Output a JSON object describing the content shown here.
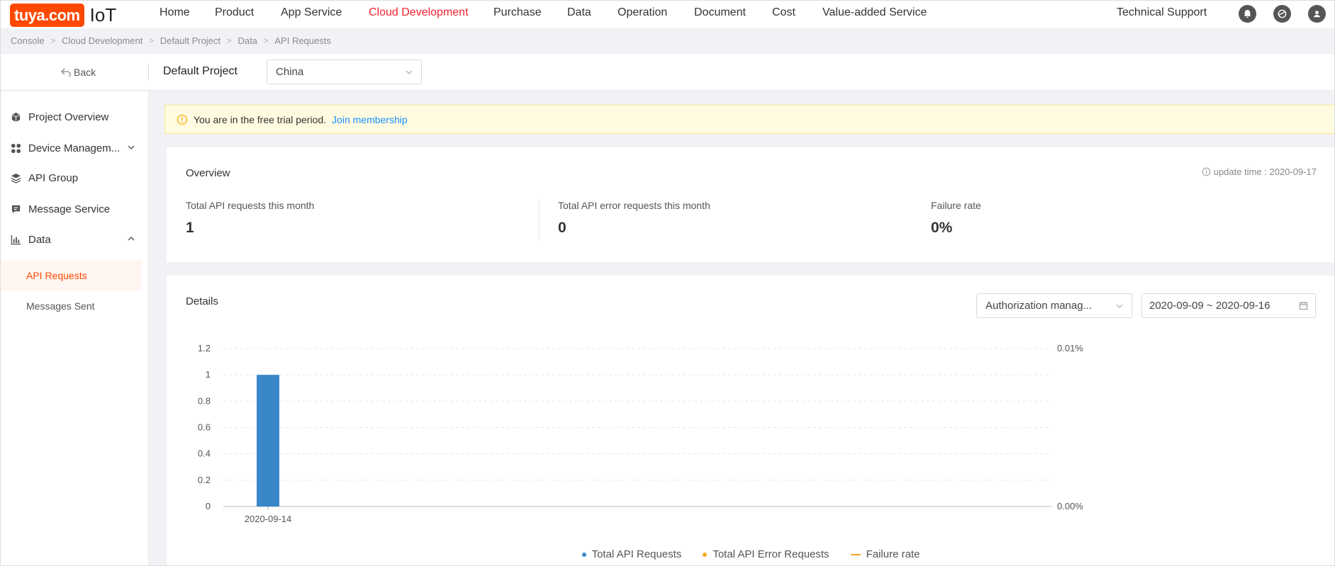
{
  "logo": {
    "brand": "tuya.com",
    "product": "IoT"
  },
  "nav": {
    "items": [
      "Home",
      "Product",
      "App Service",
      "Cloud Development",
      "Purchase",
      "Data",
      "Operation",
      "Document",
      "Cost",
      "Value-added Service"
    ],
    "active": "Cloud Development",
    "support": "Technical Support"
  },
  "breadcrumb": [
    "Console",
    "Cloud Development",
    "Default Project",
    "Data",
    "API Requests"
  ],
  "subheader": {
    "back": "Back",
    "project": "Default Project",
    "region": "China"
  },
  "sidebar": {
    "items": [
      {
        "label": "Project Overview",
        "icon": "cube-icon"
      },
      {
        "label": "Device Managem...",
        "icon": "grid-icon"
      },
      {
        "label": "API Group",
        "icon": "layers-icon"
      },
      {
        "label": "Message Service",
        "icon": "message-icon"
      },
      {
        "label": "Data",
        "icon": "bar-chart-icon"
      }
    ],
    "sub_items": [
      "API Requests",
      "Messages Sent"
    ],
    "active_sub": "API Requests"
  },
  "trial": {
    "text": "You are in the free trial period.",
    "link": "Join membership"
  },
  "overview": {
    "title": "Overview",
    "update_time": "update time : 2020-09-17",
    "stats": [
      {
        "label": "Total API requests this month",
        "value": "1"
      },
      {
        "label": "Total API error requests this month",
        "value": "0"
      },
      {
        "label": "Failure rate",
        "value": "0%"
      }
    ]
  },
  "details": {
    "title": "Details",
    "filter": "Authorization manag...",
    "date_range": "2020-09-09 ~ 2020-09-16"
  },
  "colors": {
    "brand": "#ff4800",
    "active_nav": "#f5222d",
    "link": "#1890ff",
    "bar": "#3a87c8",
    "error": "#f5a623",
    "rate": "#f5a623"
  },
  "chart_data": {
    "type": "bar",
    "categories": [
      "2020-09-14"
    ],
    "series": [
      {
        "name": "Total API Requests",
        "values": [
          1
        ]
      },
      {
        "name": "Total API Error Requests",
        "values": [
          0
        ]
      },
      {
        "name": "Failure rate",
        "values": [
          0
        ]
      }
    ],
    "y_ticks": [
      "0",
      "0.2",
      "0.4",
      "0.6",
      "0.8",
      "1",
      "1.2"
    ],
    "y2_ticks": [
      "0.00%",
      "0.01%"
    ],
    "ylim": [
      0,
      1.2
    ],
    "grid": true,
    "legend": "bottom"
  }
}
